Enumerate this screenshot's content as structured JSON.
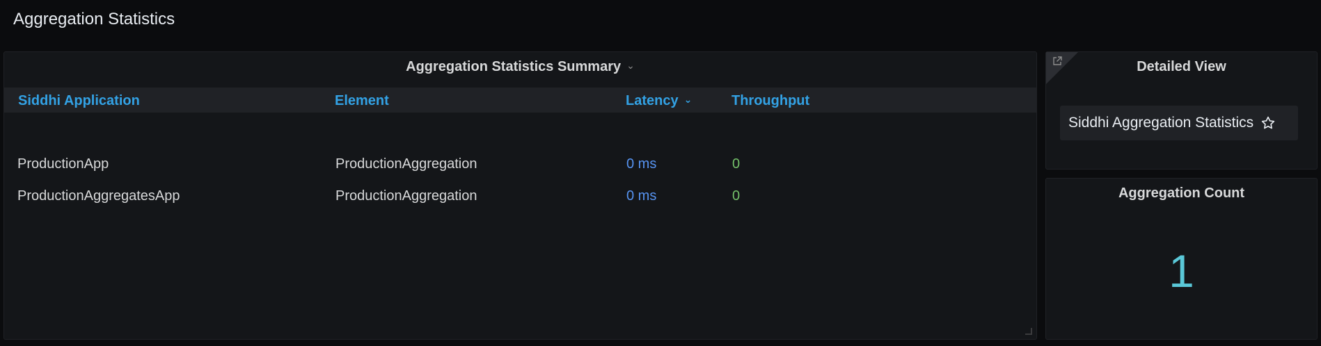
{
  "page": {
    "row_title": "Aggregation Statistics"
  },
  "summary": {
    "title": "Aggregation Statistics Summary",
    "columns": {
      "app": "Siddhi Application",
      "element": "Element",
      "latency": "Latency",
      "throughput": "Throughput"
    },
    "rows": [
      {
        "app": "ProductionApp",
        "element": "ProductionAggregation",
        "latency": "0 ms",
        "throughput": "0"
      },
      {
        "app": "ProductionAggregatesApp",
        "element": "ProductionAggregation",
        "latency": "0 ms",
        "throughput": "0"
      }
    ]
  },
  "detail": {
    "title": "Detailed View",
    "link_label": "Siddhi Aggregation Statistics"
  },
  "count": {
    "title": "Aggregation Count",
    "value": "1"
  },
  "colors": {
    "background": "#0b0c0e",
    "panel": "#141619",
    "header_blue": "#33a2e5",
    "latency_blue": "#5794f2",
    "throughput_green": "#73bf69",
    "stat_cyan": "#5ac8d8"
  },
  "icons": {
    "summary_menu": "chevron-down-icon",
    "latency_sort": "sort-desc-icon",
    "detail_corner": "external-link-icon",
    "favorite": "star-icon"
  }
}
